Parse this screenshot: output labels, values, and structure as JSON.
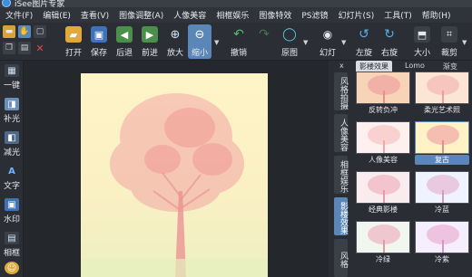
{
  "window": {
    "title": "iSee图片专家"
  },
  "menu": [
    "文件(F)",
    "编辑(E)",
    "查看(V)",
    "图像调整(A)",
    "人像美容",
    "相框娱乐",
    "图像特效",
    "PS滤镜",
    "幻灯片(S)",
    "工具(T)",
    "帮助(H)"
  ],
  "toolbar": {
    "open": "打开",
    "save": "保存",
    "back": "后退",
    "forward": "前进",
    "zoom_in": "放大",
    "zoom_out": "缩小",
    "undo": "撤销",
    "redo": "",
    "original": "原图",
    "slideshow": "幻灯",
    "rotate_left": "左旋",
    "rotate_right": "右旋",
    "size": "大小",
    "crop": "裁剪"
  },
  "leftbar": [
    "一键",
    "补光",
    "减光",
    "文字",
    "水印",
    "相框"
  ],
  "rightpanel": {
    "close": "x",
    "vertical_tabs": [
      "风格拍摄",
      "人像美容",
      "相框娱乐",
      "影楼效果",
      "风格"
    ],
    "tabs": [
      "影楼效果",
      "Lomo",
      "渐变"
    ],
    "presets": [
      {
        "name": "反转负冲",
        "selected": false
      },
      {
        "name": "柔光艺术照",
        "selected": false
      },
      {
        "name": "人像美容",
        "selected": false
      },
      {
        "name": "复古",
        "selected": true
      },
      {
        "name": "经典影楼",
        "selected": false
      },
      {
        "name": "冷蓝",
        "selected": false
      },
      {
        "name": "冷绿",
        "selected": false
      },
      {
        "name": "冷紫",
        "selected": false
      }
    ]
  },
  "colors": {
    "accent": "#5b87b8",
    "background": "#2a2d33",
    "photo_bg": "#fff4c6",
    "tree": "#f2a6a6"
  }
}
